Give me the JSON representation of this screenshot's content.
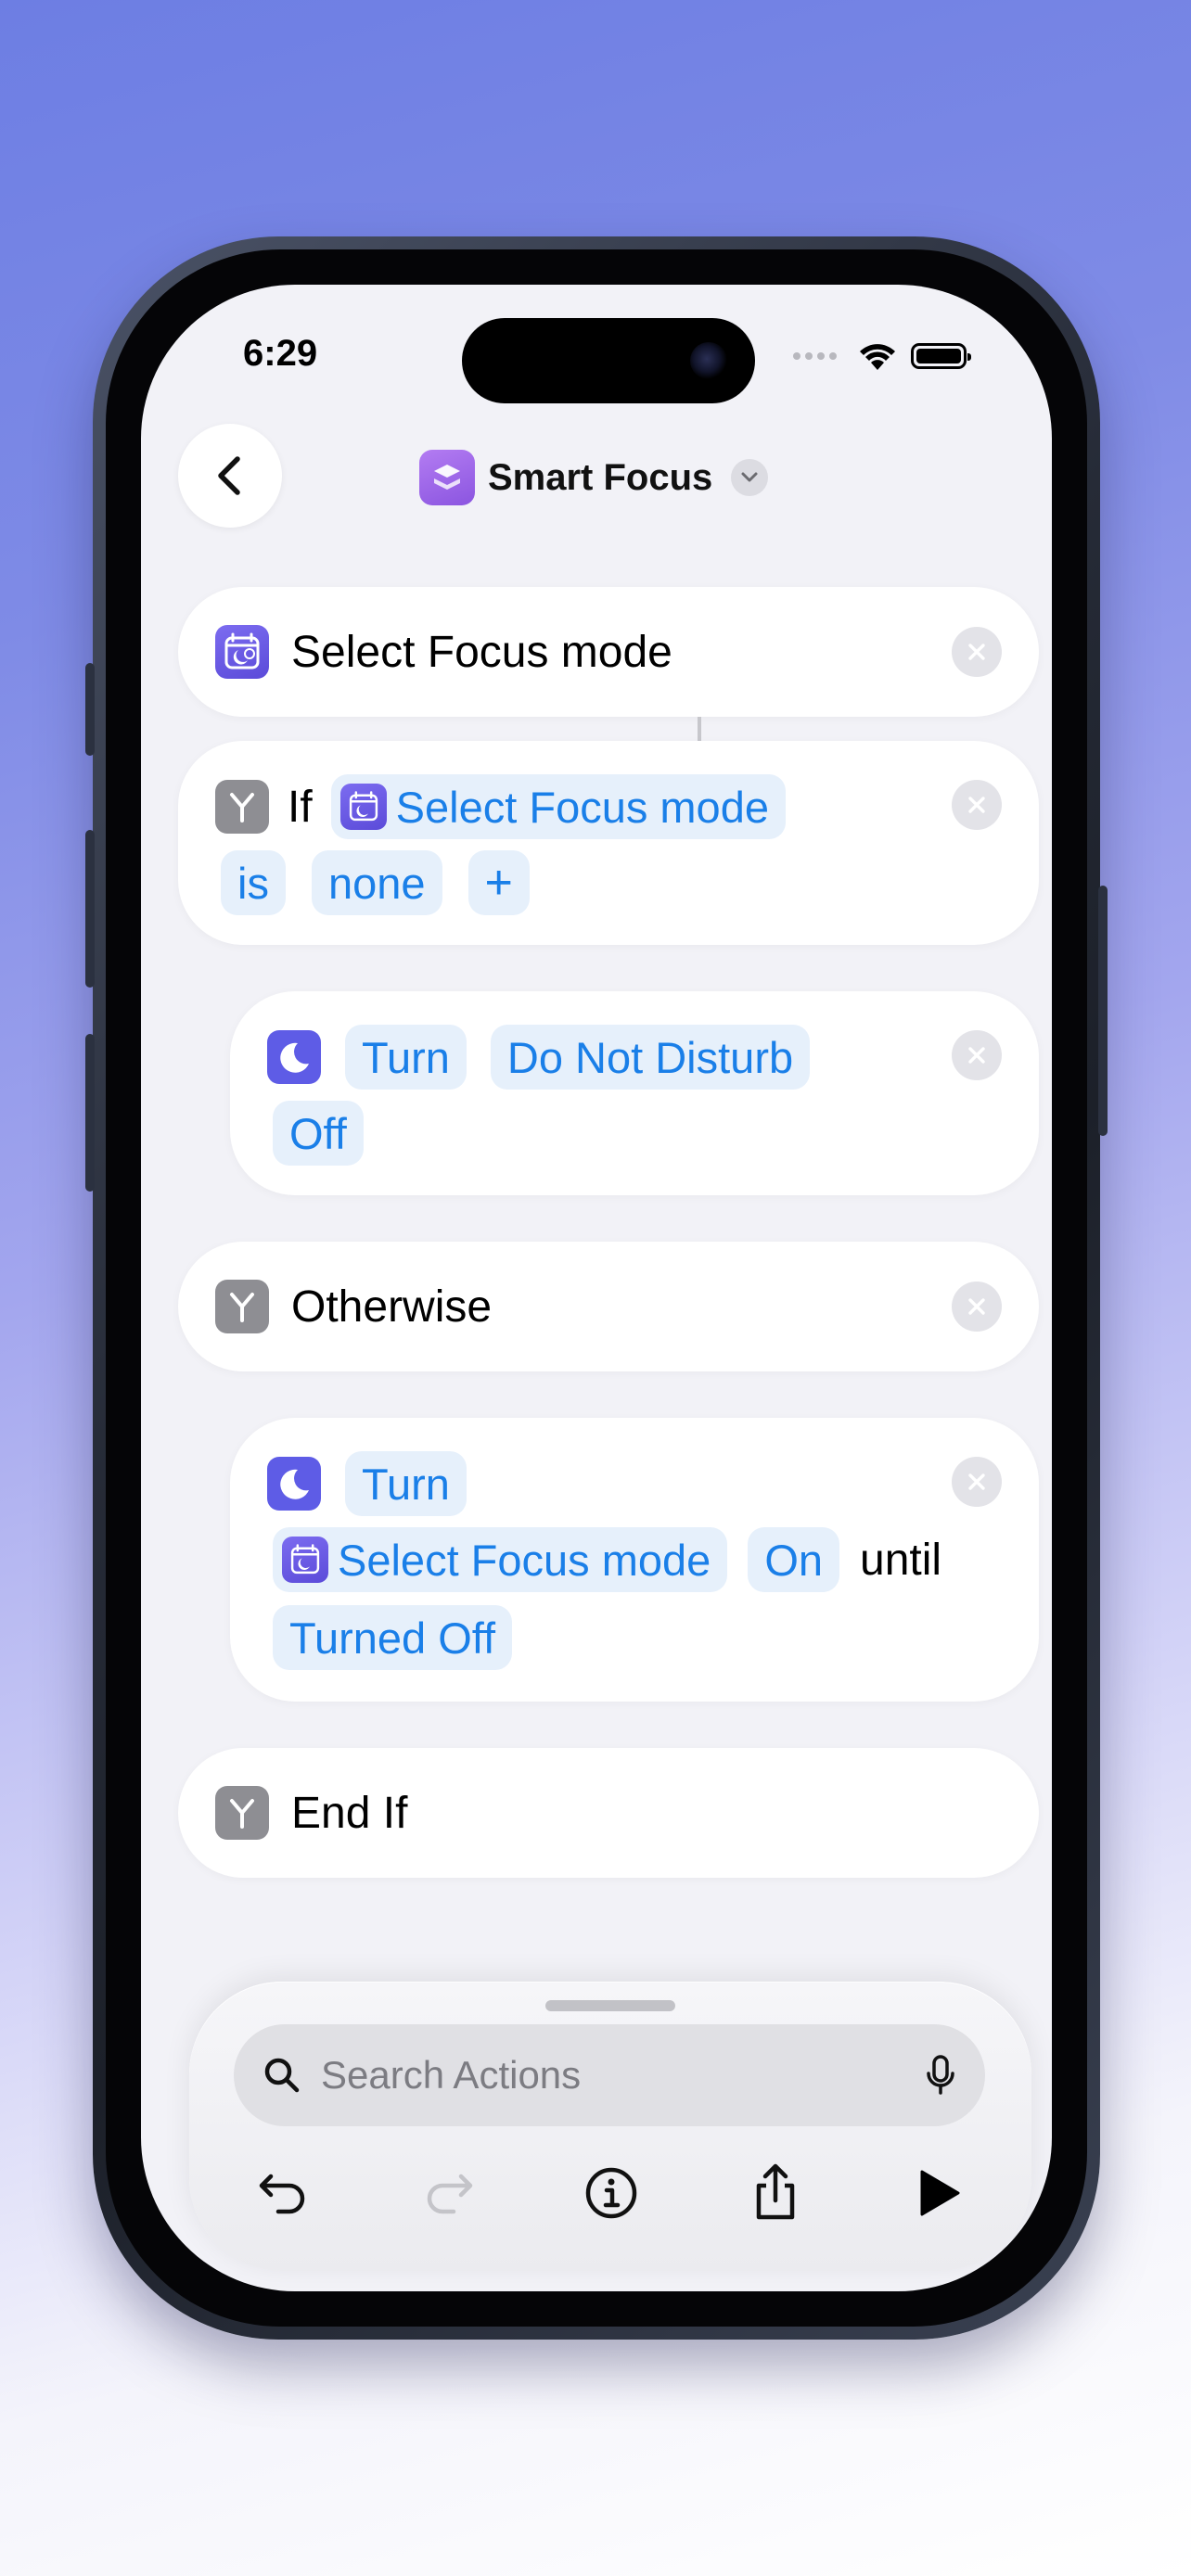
{
  "status": {
    "time": "6:29"
  },
  "header": {
    "title": "Smart Focus"
  },
  "actions": {
    "select_focus": {
      "label": "Select Focus mode"
    },
    "if_block": {
      "keyword": "If",
      "variable": "Select Focus mode",
      "operator": "is",
      "value": "none",
      "add": "+"
    },
    "turn_dnd": {
      "verb": "Turn",
      "target": "Do Not Disturb",
      "state": "Off"
    },
    "otherwise": {
      "label": "Otherwise"
    },
    "turn_focus": {
      "verb": "Turn",
      "variable": "Select Focus mode",
      "state": "On",
      "until": "until",
      "until_value": "Turned Off"
    },
    "end_if": {
      "label": "End If"
    }
  },
  "bottom_sheet": {
    "search_placeholder": "Search Actions"
  },
  "colors": {
    "accent": "#1a7fe8",
    "pill_bg": "#e6f0fb",
    "moon_icon": "#5e5ce6",
    "focus_icon": "#6b5ce6",
    "app_icon": "#a06be8"
  }
}
